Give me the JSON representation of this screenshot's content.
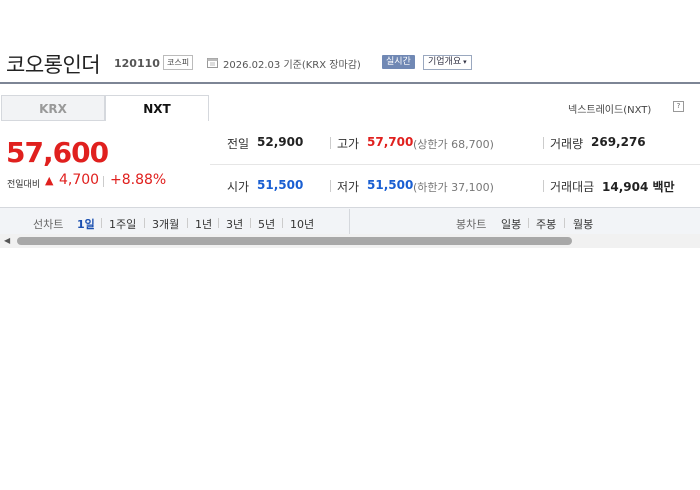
{
  "header": {
    "title": "코오롱인더",
    "code": "120110",
    "market": "코스피",
    "date": "2026.02.03",
    "basis": "기준(KRX 장마감)",
    "realtime": "실시간",
    "company_info": "기업개요"
  },
  "tabs": [
    {
      "label": "KRX",
      "active": false
    },
    {
      "label": "NXT",
      "active": true
    }
  ],
  "nxt_link": "넥스트레이드(NXT)",
  "price": {
    "current": "57,600",
    "change_label": "전일대비",
    "change_value": "4,700",
    "change_rate": "+8.88%"
  },
  "stats": {
    "prev_close": {
      "label": "전일",
      "value": "52,900"
    },
    "high": {
      "label": "고가",
      "value": "57,700",
      "sub": "(상한가 68,700)"
    },
    "volume": {
      "label": "거래량",
      "value": "269,276"
    },
    "open": {
      "label": "시가",
      "value": "51,500"
    },
    "low": {
      "label": "저가",
      "value": "51,500",
      "sub": "(하한가 37,100)"
    },
    "amount": {
      "label": "거래대금",
      "value": "14,904",
      "unit": "백만"
    }
  },
  "chart_tabs": {
    "line_label": "선차트",
    "line_periods": [
      "1일",
      "1주일",
      "3개월",
      "1년",
      "3년",
      "5년",
      "10년"
    ],
    "candle_label": "봉차트",
    "candle_periods": [
      "일봉",
      "주봉",
      "월봉"
    ],
    "active": "1일"
  },
  "colors": {
    "up": "#e0201e",
    "down": "#1a5fd2",
    "active_tab": "#1a4fb0",
    "realtime_badge": "#7088b4"
  }
}
